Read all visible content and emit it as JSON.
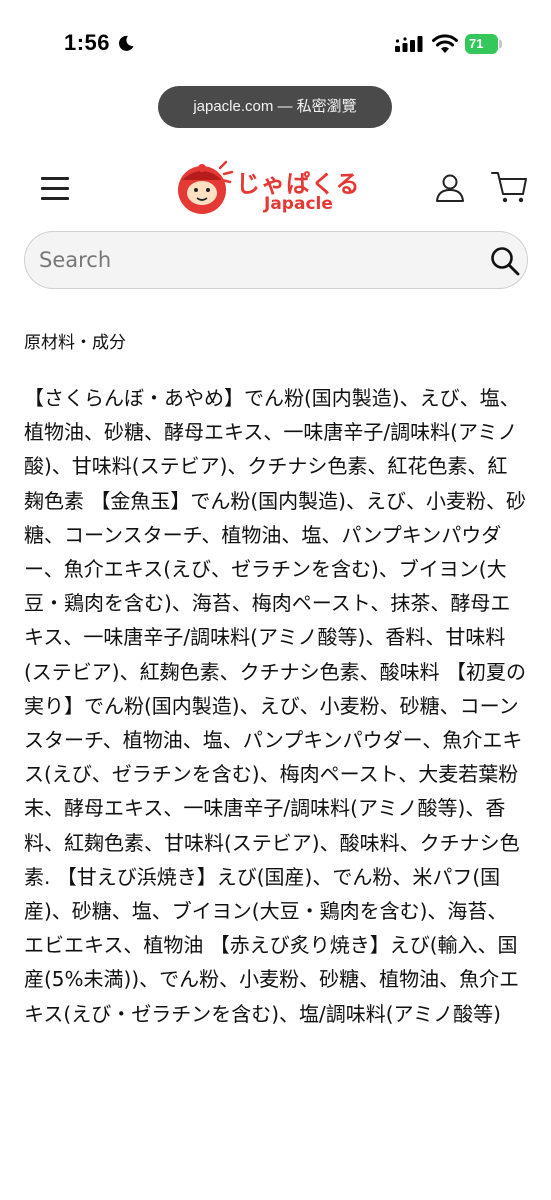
{
  "status_bar": {
    "time": "1:56",
    "battery_level": "71",
    "icons": [
      "moon-icon",
      "signal-icon",
      "wifi-icon",
      "battery-icon"
    ]
  },
  "browser": {
    "url_label": "japacle.com — 私密瀏覽"
  },
  "header": {
    "logo_text_jp": "じゃぱくる",
    "logo_text_en": "Japacle",
    "icons": [
      "menu-icon",
      "account-icon",
      "cart-icon"
    ]
  },
  "search": {
    "placeholder": "Search"
  },
  "content": {
    "section_title": "原材料・成分",
    "ingredients": "【さくらんぼ・あやめ】でん粉(国内製造)、えび、塩、植物油、砂糖、酵母エキス、一味唐辛子/調味料(アミノ酸)、甘味料(ステビア)、クチナシ色素、紅花色素、紅麹色素 【金魚玉】でん粉(国内製造)、えび、小麦粉、砂糖、コーンスターチ、植物油、塩、パンプキンパウダー、魚介エキス(えび、ゼラチンを含む)、ブイヨン(大豆・鶏肉を含む)、海苔、梅肉ペースト、抹茶、酵母エキス、一味唐辛子/調味料(アミノ酸等)、香料、甘味料(ステビア)、紅麹色素、クチナシ色素、酸味料 【初夏の実り】でん粉(国内製造)、えび、小麦粉、砂糖、コーンスターチ、植物油、塩、パンプキンパウダー、魚介エキス(えび、ゼラチンを含む)、梅肉ペースト、大麦若葉粉末、酵母エキス、一味唐辛子/調味料(アミノ酸等)、香料、紅麹色素、甘味料(ステビア)、酸味料、クチナシ色素. 【甘えび浜焼き】えび(国産)、でん粉、米パフ(国産)、砂糖、塩、ブイヨン(大豆・鶏肉を含む)、海苔、エビエキス、植物油 【赤えび炙り焼き】えび(輸入、国産(5%未満))、でん粉、小麦粉、砂糖、植物油、魚介エキス(えび・ゼラチンを含む)、塩/調味料(アミノ酸等)"
  },
  "colors": {
    "brand": "#e53935",
    "battery": "#34c759",
    "url_pill": "#4a4a4a"
  }
}
